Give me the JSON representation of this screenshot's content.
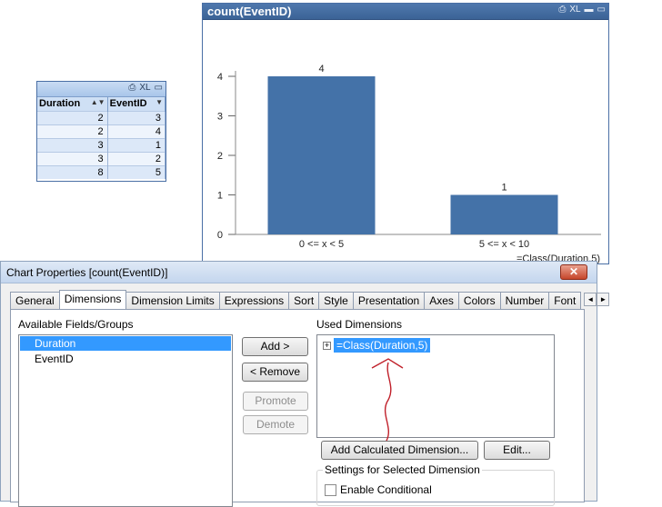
{
  "table_box": {
    "caption_icons": [
      "print-icon",
      "excel-icon",
      "maximize-icon"
    ],
    "caption_xl": "XL",
    "headers": [
      "Duration",
      "EventID"
    ],
    "rows": [
      [
        "2",
        "3"
      ],
      [
        "2",
        "4"
      ],
      [
        "3",
        "1"
      ],
      [
        "3",
        "2"
      ],
      [
        "8",
        "5"
      ]
    ]
  },
  "chart_window": {
    "title": "count(EventID)",
    "caption_xl": "XL",
    "x_axis_title": "=Class(Duration,5)"
  },
  "chart_data": {
    "type": "bar",
    "title": "count(EventID)",
    "categories": [
      "0 <= x < 5",
      "5 <= x < 10"
    ],
    "values": [
      4,
      1
    ],
    "data_labels": [
      "4",
      "1"
    ],
    "xlabel": "=Class(Duration,5)",
    "ylabel": "",
    "ylim": [
      0,
      4
    ],
    "yticks": [
      "0",
      "1",
      "2",
      "3",
      "4"
    ],
    "bar_color": "#4472a8",
    "grid": false,
    "legend": false
  },
  "dialog": {
    "title": "Chart Properties [count(EventID)]",
    "close_label": "✕",
    "tabs": [
      "General",
      "Dimensions",
      "Dimension Limits",
      "Expressions",
      "Sort",
      "Style",
      "Presentation",
      "Axes",
      "Colors",
      "Number",
      "Font"
    ],
    "active_tab": "Dimensions",
    "tab_scroll": [
      "◄",
      "►"
    ],
    "available_label": "Available Fields/Groups",
    "available_items": [
      "Duration",
      "EventID"
    ],
    "used_label": "Used Dimensions",
    "used_items": [
      "=Class(Duration,5)"
    ],
    "expand_glyph": "+",
    "buttons": {
      "add": "Add >",
      "remove": "< Remove",
      "promote": "Promote",
      "demote": "Demote",
      "add_calculated": "Add Calculated Dimension...",
      "edit": "Edit..."
    },
    "settings_label": "Settings for Selected Dimension",
    "enable_conditional": "Enable Conditional"
  },
  "colors": {
    "accent": "#3399ff",
    "annotation": "#c0202a",
    "bar": "#4472a8"
  }
}
